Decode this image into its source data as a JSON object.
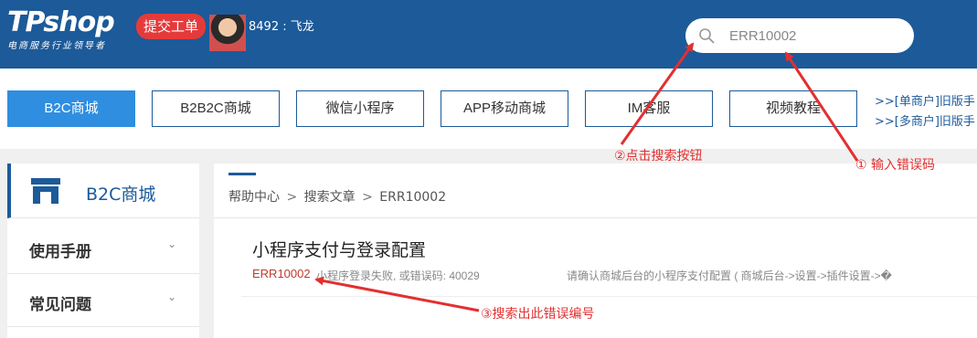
{
  "header": {
    "logo_text": "TPshop",
    "logo_tagline": "电商服务行业领导者",
    "ticket_button": "提交工单",
    "user_label": "8492 : 飞龙",
    "search_value": "ERR10002"
  },
  "nav": {
    "buttons": [
      "B2C商城",
      "B2B2C商城",
      "微信小程序",
      "APP移动商城",
      "IM客服",
      "视频教程"
    ],
    "active_index": 0,
    "old_links": [
      ">>[单商户]旧版手",
      ">>[多商户]旧版手"
    ]
  },
  "sidebar": {
    "title": "B2C商城",
    "items": [
      "使用手册",
      "常见问题"
    ],
    "chevron": "⌄"
  },
  "main": {
    "breadcrumb": [
      "帮助中心",
      "搜索文章",
      "ERR10002"
    ],
    "breadcrumb_sep": ">",
    "result": {
      "title": "小程序支付与登录配置",
      "code": "ERR10002",
      "snippet": "小程序登录失败, 或错误码: 40029",
      "snippet2": "请确认商城后台的小程序支付配置 ( 商城后台->设置->插件设置->�"
    }
  },
  "annotations": {
    "step1": "① 输入错误码",
    "step2": "②点击搜索按钮",
    "step3": "③搜索出此错误编号"
  },
  "colors": {
    "header_bg": "#1c5a99",
    "active_nav": "#2f8ee0",
    "annotation_red": "#e23030",
    "ticket_red": "#e53a3a"
  }
}
